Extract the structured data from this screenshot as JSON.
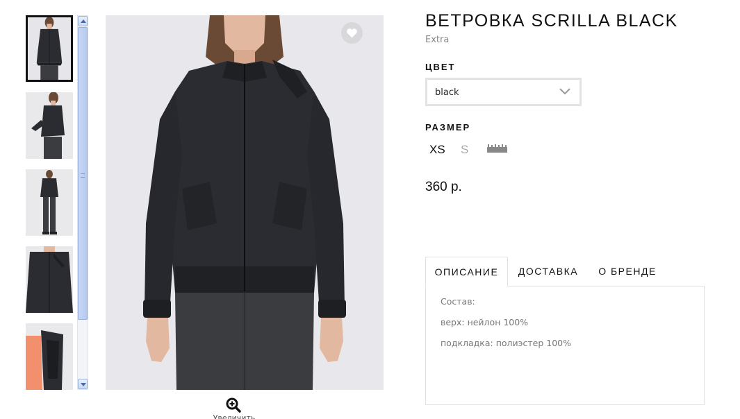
{
  "product": {
    "title": "ВЕТРОВКА SCRILLA BLACK",
    "brand": "Extra",
    "price": "360 р."
  },
  "color": {
    "label": "ЦВЕТ",
    "selected": "black"
  },
  "size": {
    "label": "РАЗМЕР",
    "options": [
      {
        "label": "XS",
        "available": true
      },
      {
        "label": "S",
        "available": false
      }
    ]
  },
  "gallery": {
    "thumbnail_count": 5,
    "selected_index": 0,
    "zoom_label": "Увеличить"
  },
  "tabs": [
    {
      "label": "ОПИСАНИЕ",
      "active": true
    },
    {
      "label": "ДОСТАВКА",
      "active": false
    },
    {
      "label": "О БРЕНДЕ",
      "active": false
    }
  ],
  "description": [
    "Состав:",
    "верх: нейлон 100%",
    "подкладка: полиэстер 100%"
  ],
  "icons": {
    "favorite": "heart-icon",
    "color_dropdown": "chevron-down-icon",
    "size_guide": "ruler-icon",
    "zoom": "zoom-in-icon"
  },
  "colors": {
    "jacket": "#2a2c31",
    "pants": "#3b3c40",
    "skin": "#e3b8a0",
    "hair": "#6b4a35",
    "photo_bg": "#e8e8ec"
  }
}
